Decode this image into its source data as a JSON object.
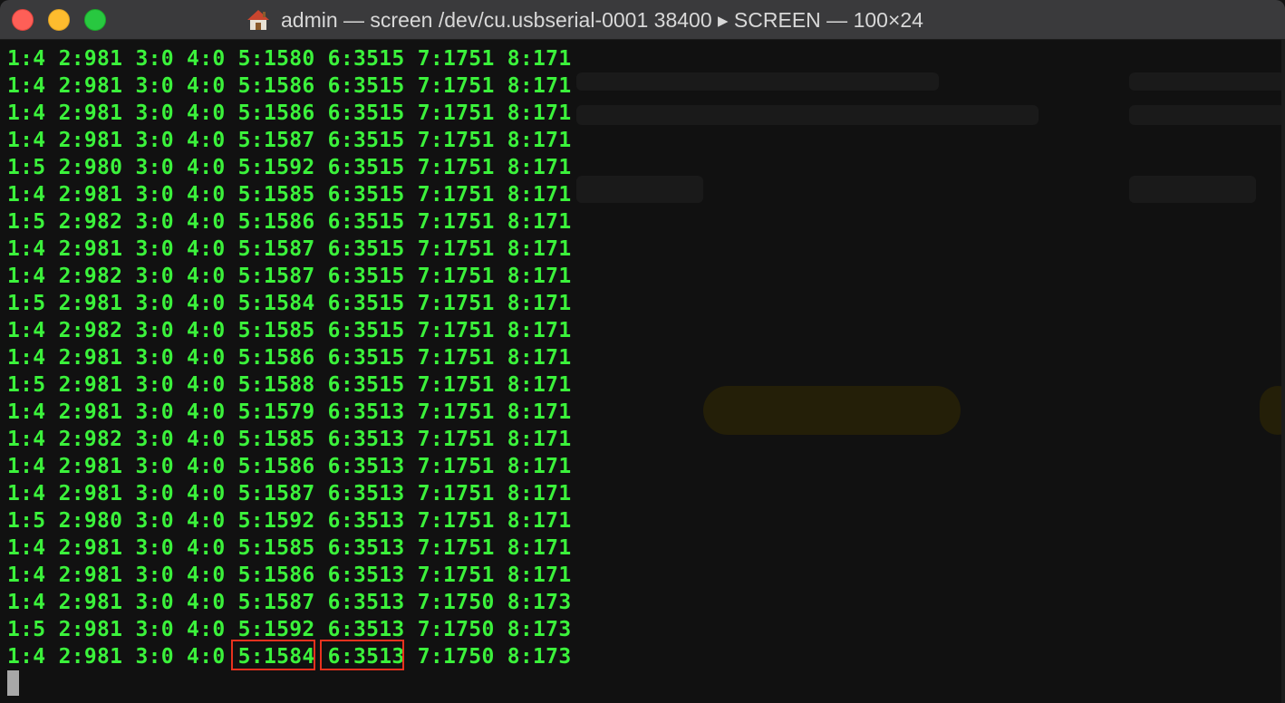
{
  "window": {
    "title": "admin — screen /dev/cu.usbserial-0001 38400 ▸ SCREEN — 100×24",
    "icons": {
      "home": "home-icon",
      "close": "close-button",
      "minimize": "minimize-button",
      "zoom": "zoom-button"
    },
    "colors": {
      "terminal_text": "#3bf23b",
      "background": "#111111",
      "highlight_box": "#e8321e"
    }
  },
  "terminal": {
    "lines": [
      "1:4 2:981 3:0 4:0 5:1580 6:3515 7:1751 8:171",
      "1:4 2:981 3:0 4:0 5:1586 6:3515 7:1751 8:171",
      "1:4 2:981 3:0 4:0 5:1586 6:3515 7:1751 8:171",
      "1:4 2:981 3:0 4:0 5:1587 6:3515 7:1751 8:171",
      "1:5 2:980 3:0 4:0 5:1592 6:3515 7:1751 8:171",
      "1:4 2:981 3:0 4:0 5:1585 6:3515 7:1751 8:171",
      "1:5 2:982 3:0 4:0 5:1586 6:3515 7:1751 8:171",
      "1:4 2:981 3:0 4:0 5:1587 6:3515 7:1751 8:171",
      "1:4 2:982 3:0 4:0 5:1587 6:3515 7:1751 8:171",
      "1:5 2:981 3:0 4:0 5:1584 6:3515 7:1751 8:171",
      "1:4 2:982 3:0 4:0 5:1585 6:3515 7:1751 8:171",
      "1:4 2:981 3:0 4:0 5:1586 6:3515 7:1751 8:171",
      "1:5 2:981 3:0 4:0 5:1588 6:3515 7:1751 8:171",
      "1:4 2:981 3:0 4:0 5:1579 6:3513 7:1751 8:171",
      "1:4 2:982 3:0 4:0 5:1585 6:3513 7:1751 8:171",
      "1:4 2:981 3:0 4:0 5:1586 6:3513 7:1751 8:171",
      "1:4 2:981 3:0 4:0 5:1587 6:3513 7:1751 8:171",
      "1:5 2:980 3:0 4:0 5:1592 6:3513 7:1751 8:171",
      "1:4 2:981 3:0 4:0 5:1585 6:3513 7:1751 8:171",
      "1:4 2:981 3:0 4:0 5:1586 6:3513 7:1751 8:171",
      "1:4 2:981 3:0 4:0 5:1587 6:3513 7:1750 8:173",
      "1:5 2:981 3:0 4:0 5:1592 6:3513 7:1750 8:173",
      "1:4 2:981 3:0 4:0 5:1584 6:3513 7:1750 8:173"
    ],
    "highlighted_values": [
      "5:1584",
      "6:3513"
    ]
  }
}
